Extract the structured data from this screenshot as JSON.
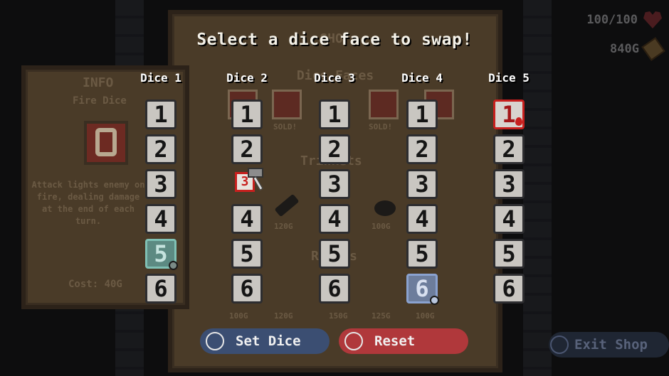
{
  "hud": {
    "hp": "100/100",
    "gold": "840G"
  },
  "shop": {
    "title": "SHOP",
    "section_faces": "Dice Faces",
    "section_trinkets": "Trinkets",
    "section_relics": "Relics",
    "sold_label": "SOLD!",
    "trinket_prices": [
      "120G",
      "100G"
    ],
    "relic_prices": [
      "100G",
      "120G",
      "150G",
      "125G",
      "100G"
    ]
  },
  "info": {
    "title": "INFO",
    "item_name": "Fire Dice",
    "description": "Attack lights enemy on fire, dealing damage at the end of each turn.",
    "cost": "Cost: 40G"
  },
  "heading": "Select a dice face to swap!",
  "dice": [
    {
      "label": "Dice 1",
      "faces": [
        "1",
        "2",
        "3",
        "4",
        "5",
        "6"
      ]
    },
    {
      "label": "Dice 2",
      "faces": [
        "1",
        "2",
        "3",
        "4",
        "5",
        "6"
      ]
    },
    {
      "label": "Dice 3",
      "faces": [
        "1",
        "2",
        "3",
        "4",
        "5",
        "6"
      ]
    },
    {
      "label": "Dice 4",
      "faces": [
        "1",
        "2",
        "3",
        "4",
        "5",
        "6"
      ]
    },
    {
      "label": "Dice 5",
      "faces": [
        "1",
        "2",
        "3",
        "4",
        "5",
        "6"
      ]
    }
  ],
  "cursor_face": "3",
  "buttons": {
    "set_dice": "Set Dice",
    "reset": "Reset",
    "exit_shop": "Exit Shop"
  },
  "colors": {
    "heading": "#f4f1e8",
    "set_button": "#3b4e72",
    "reset_button": "#b0383b",
    "fire_red": "#c8201e"
  }
}
